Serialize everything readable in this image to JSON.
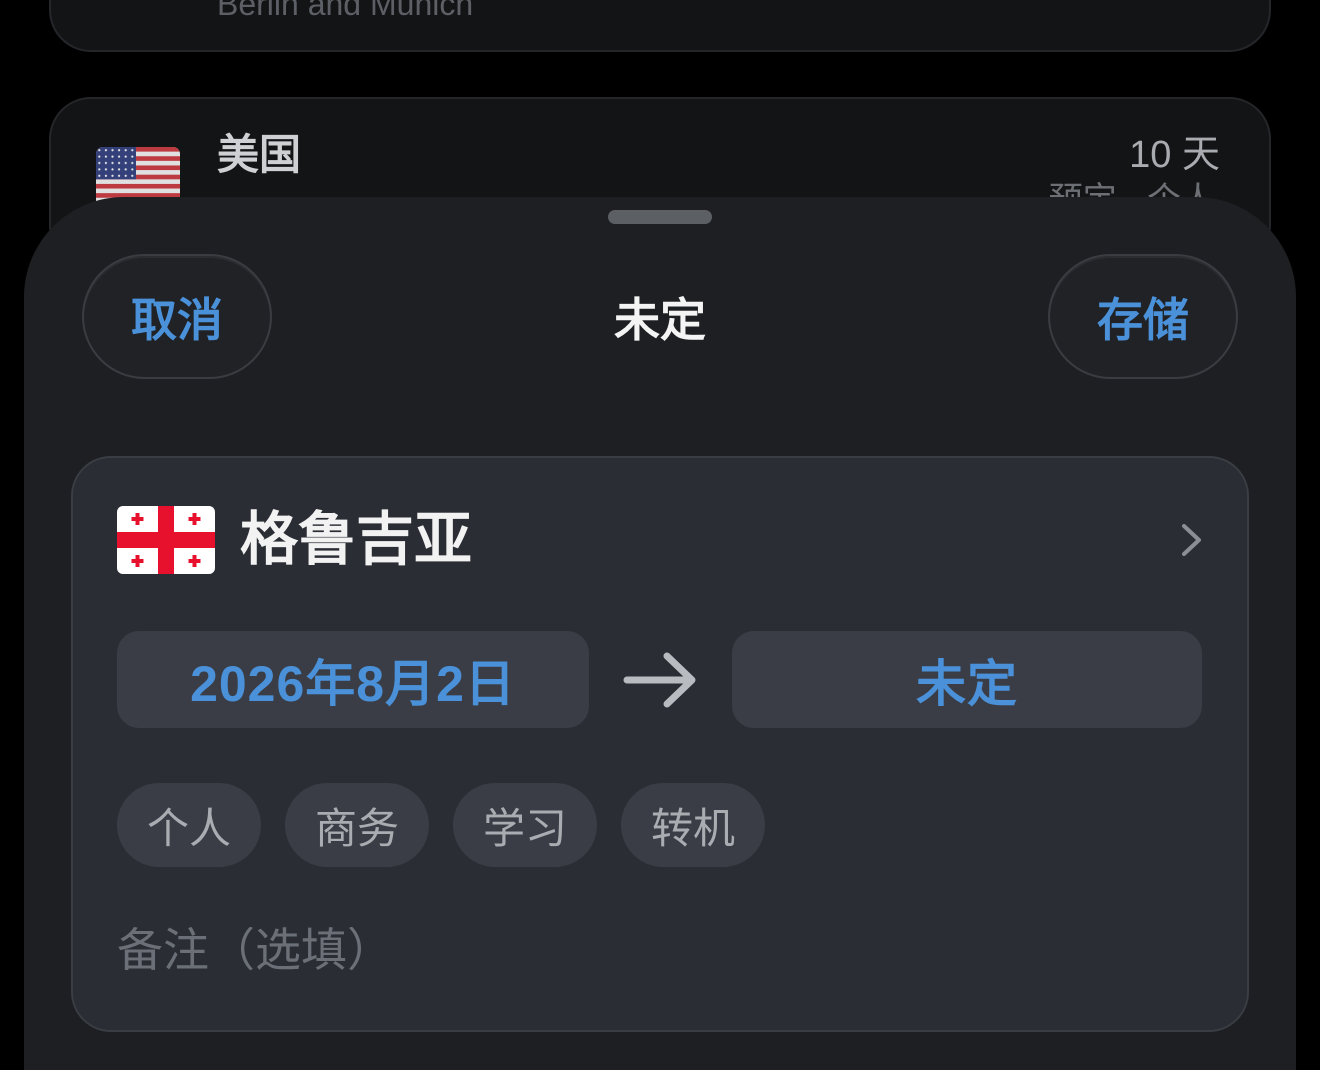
{
  "background_list": {
    "top_card": {
      "subtitle": "Berlin and Munich"
    },
    "us_card": {
      "flag_icon": "us-flag-icon",
      "title": "美国",
      "duration": "10 天",
      "meta": "预定 · 个人"
    }
  },
  "sheet": {
    "grabber_icon": "sheet-grabber",
    "cancel_label": "取消",
    "title": "未定",
    "save_label": "存储"
  },
  "trip": {
    "country_flag_icon": "georgia-flag-icon",
    "country": "格鲁吉亚",
    "chevron_icon": "chevron-right-icon",
    "start_date": "2026年8月2日",
    "arrow_icon": "arrow-right-icon",
    "end_date": "未定",
    "purpose_tags": [
      {
        "label": "个人"
      },
      {
        "label": "商务"
      },
      {
        "label": "学习"
      },
      {
        "label": "转机"
      }
    ],
    "notes": {
      "value": "",
      "placeholder": "备注（选填）"
    }
  },
  "colors": {
    "accent": "#4a91d9",
    "sheet_background": "#1e1f22",
    "card_background": "#2a2d34",
    "pill_background": "#3a3d45"
  }
}
